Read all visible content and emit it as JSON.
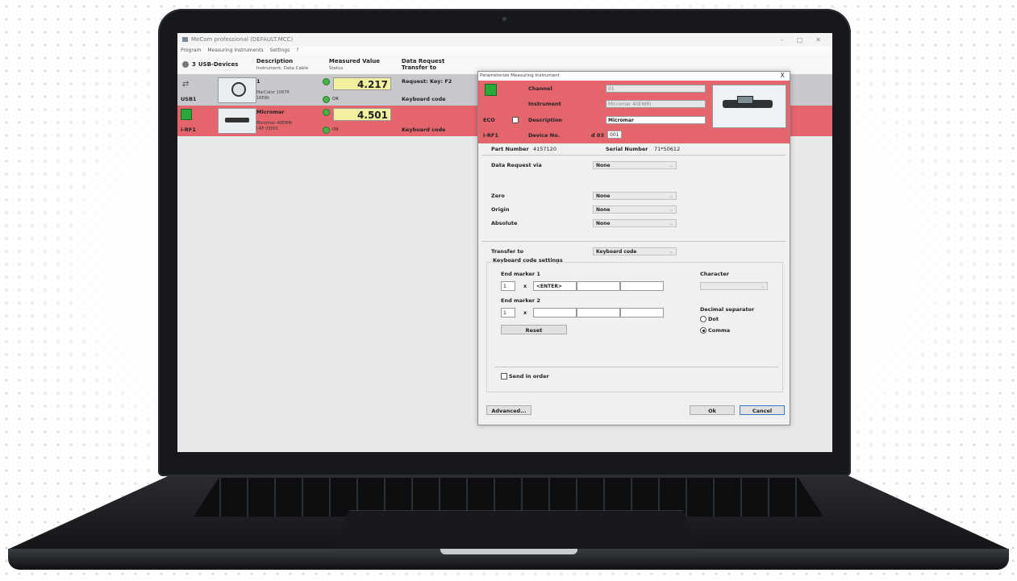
{
  "app": {
    "title": "MeCom professional  (DEFAULT.MCC)",
    "menu": [
      "Program",
      "Measuring Instruments",
      "Settings",
      "?"
    ],
    "window_controls": [
      "–",
      "□",
      "✕"
    ]
  },
  "header": {
    "device_count": "3",
    "devices_label": "USB-Devices",
    "col_description": "Description",
    "col_description_sub": "Instrument, Data Cable",
    "col_value": "Measured Value",
    "col_value_sub": "Status",
    "col_request": "Data Request",
    "col_transfer": "Transfer to"
  },
  "rows": [
    {
      "port": "USB1",
      "name": "1",
      "detail1": "MarCator 1087R",
      "detail2": "16EWr",
      "value": "4.217",
      "status": "OK",
      "request": "Request: Key: F2",
      "transfer": "Keyboard code"
    },
    {
      "port": "i-RF1",
      "name": "Micromar",
      "detail1": "Micromar 40EWRi",
      "detail2": "i-RF 03001",
      "value": "4.501",
      "status": "OK",
      "request": "",
      "transfer": "Keyboard code"
    }
  ],
  "dialog": {
    "title": "Parameterize Measuring Instrument",
    "close": "X",
    "channel_label": "Channel",
    "channel_value": "01",
    "instrument_label": "Instrument",
    "instrument_value": "Micromar 40EWRi",
    "eco_label": "ECO",
    "description_label": "Description",
    "description_value": "Micromar",
    "irf_label": "i-RF1",
    "device_no_label": "Device No.",
    "device_no_prefix": "d 03",
    "device_no_value": "001",
    "part_number_label": "Part Number",
    "part_number_value": "4157120",
    "serial_label": "Serial Number",
    "serial_value": "71*50612",
    "data_request_label": "Data Request via",
    "data_request_value": "None",
    "zero_label": "Zero",
    "zero_value": "None",
    "origin_label": "Origin",
    "origin_value": "None",
    "absolute_label": "Absolute",
    "absolute_value": "None",
    "transfer_label": "Transfer to",
    "transfer_value": "Keyboard code",
    "kb_settings_label": "Keyboard code settings",
    "end_marker1_label": "End marker 1",
    "em1_count": "1",
    "em1_x": "x",
    "em1_value": "<ENTER>",
    "end_marker2_label": "End marker 2",
    "em2_count": "1",
    "em2_x": "x",
    "reset_label": "Reset",
    "character_label": "Character",
    "decimal_label": "Decimal separator",
    "dot_label": "Dot",
    "comma_label": "Comma",
    "send_order_label": "Send in order",
    "advanced_label": "Advanced...",
    "ok_label": "Ok",
    "cancel_label": "Cancel"
  }
}
